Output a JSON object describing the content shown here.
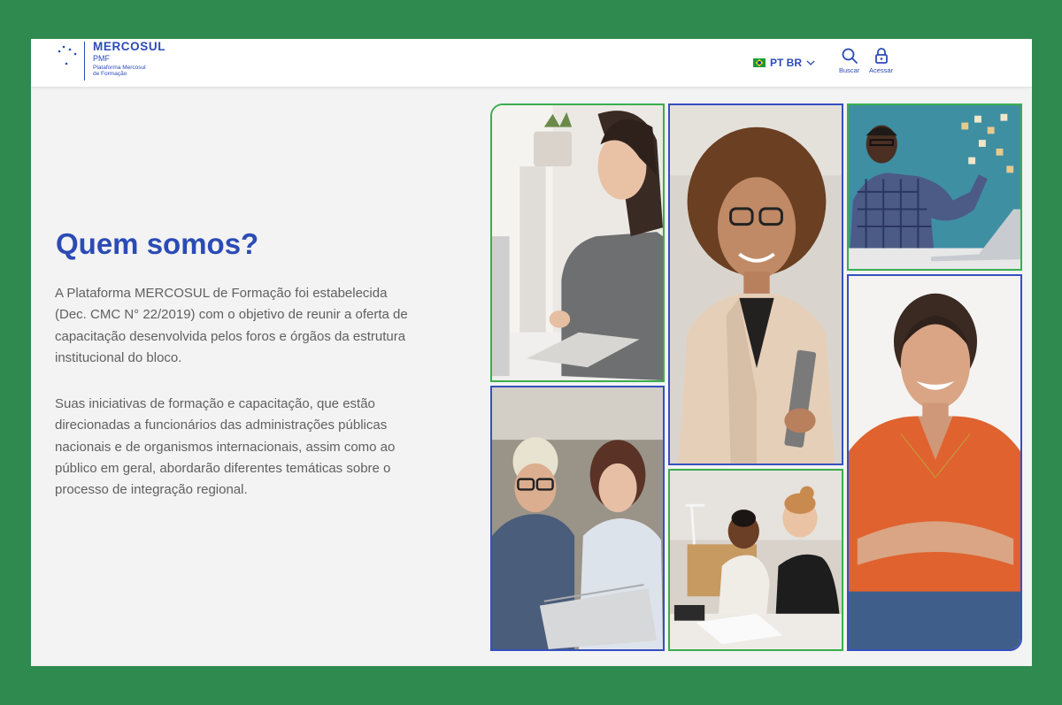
{
  "header": {
    "logo": {
      "title": "MERCOSUL",
      "abbr": "PMF",
      "subtitle_line1": "Plataforma Mercosul",
      "subtitle_line2": "de Formação"
    },
    "language": {
      "label": "PT BR"
    },
    "search_label": "Buscar",
    "access_label": "Acessar"
  },
  "main": {
    "heading": "Quem somos?",
    "paragraph1": "A Plataforma MERCOSUL de Formação foi estabelecida (Dec. CMC N° 22/2019) com o objetivo de reunir a oferta de capacitação desenvolvida pelos foros e órgãos da estrutura institucional do bloco.",
    "paragraph2": "Suas iniciativas de formação e capacitação, que estão direcionadas a funcionários das administrações públicas nacionais e de organismos internacionais, assim como ao público em geral, abordarão diferentes temáticas sobre o processo de integração regional."
  },
  "colors": {
    "outer_background": "#2e8a4f",
    "brand_blue": "#2b4bb5",
    "frame_green": "#3aae4e",
    "frame_blue": "#3550c0",
    "text_gray": "#606060"
  },
  "icons": [
    "stars-icon",
    "brazil-flag-icon",
    "chevron-down-icon",
    "search-icon",
    "lock-icon"
  ]
}
